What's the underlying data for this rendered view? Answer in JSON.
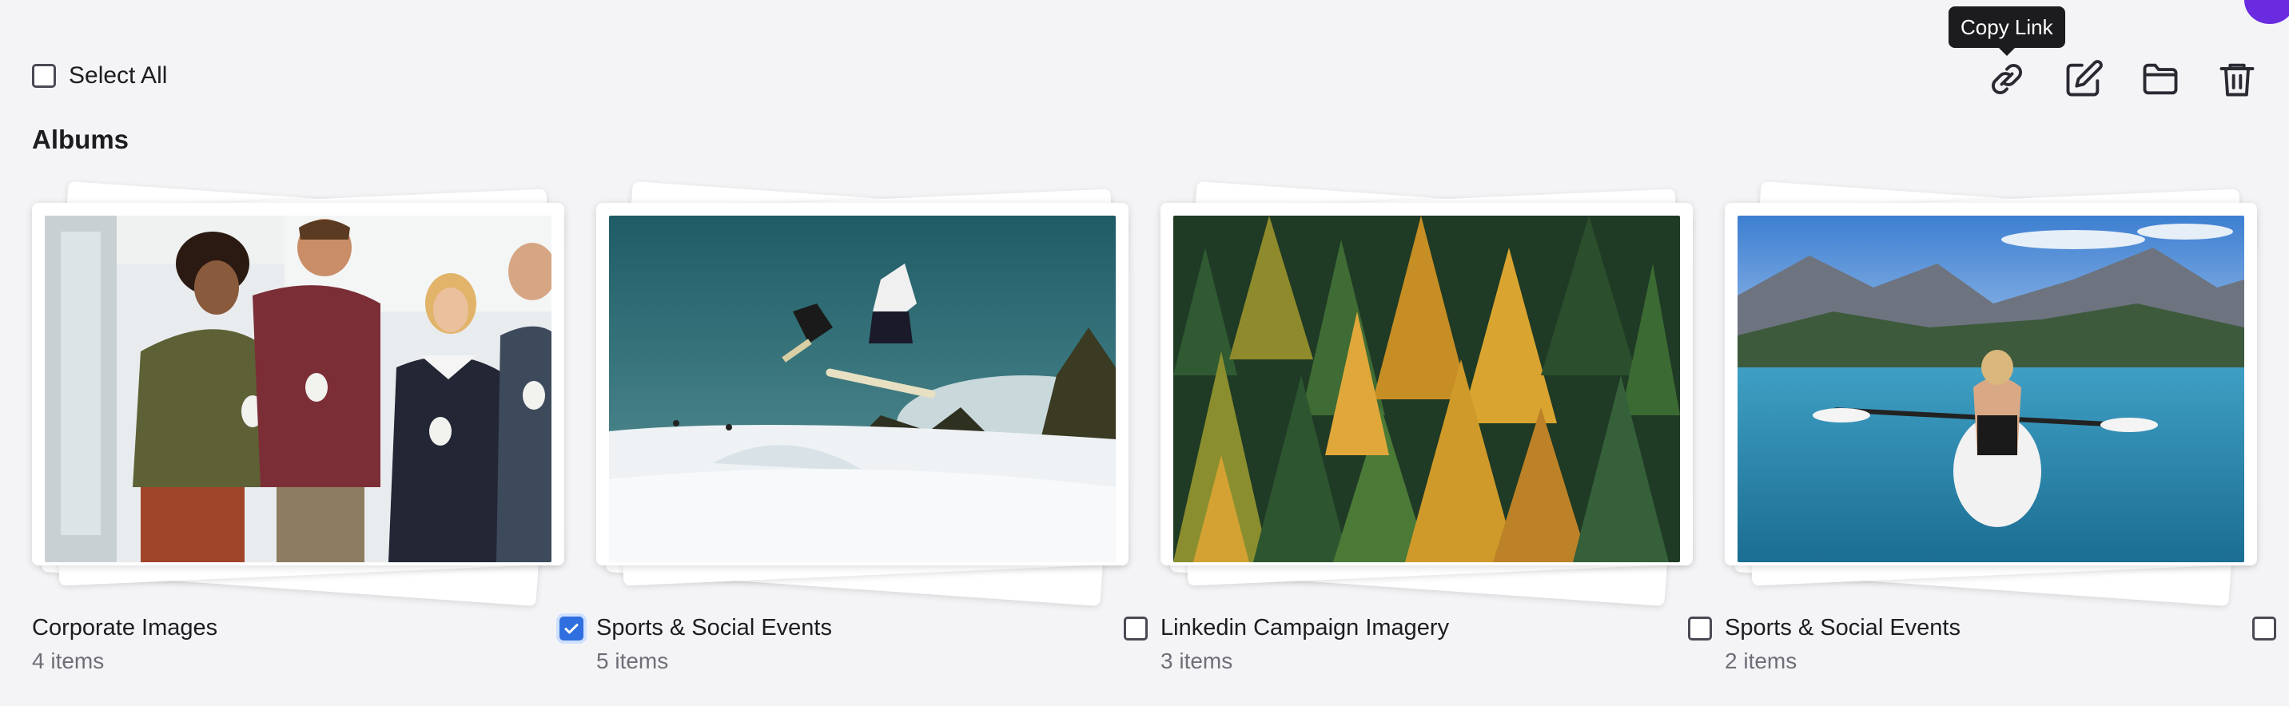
{
  "toolbar": {
    "select_all_label": "Select All",
    "tooltip": "Copy Link",
    "icons": [
      "link-icon",
      "edit-icon",
      "folder-icon",
      "trash-icon"
    ]
  },
  "section_title": "Albums",
  "colors": {
    "accent": "#2f6fe0",
    "brand_avatar": "#6a2be0",
    "tooltip_bg": "#1c1c1e"
  },
  "albums": [
    {
      "title": "Corporate Images",
      "count": "4 items",
      "checked": true,
      "image": "office-people-coffee"
    },
    {
      "title": "Sports & Social Events",
      "count": "5 items",
      "checked": false,
      "image": "snowboard-jump"
    },
    {
      "title": "Linkedin Campaign Imagery",
      "count": "3 items",
      "checked": false,
      "image": "autumn-forest"
    },
    {
      "title": "Sports & Social Events",
      "count": "2 items",
      "checked": false,
      "image": "kayak-lake-mountains"
    }
  ]
}
